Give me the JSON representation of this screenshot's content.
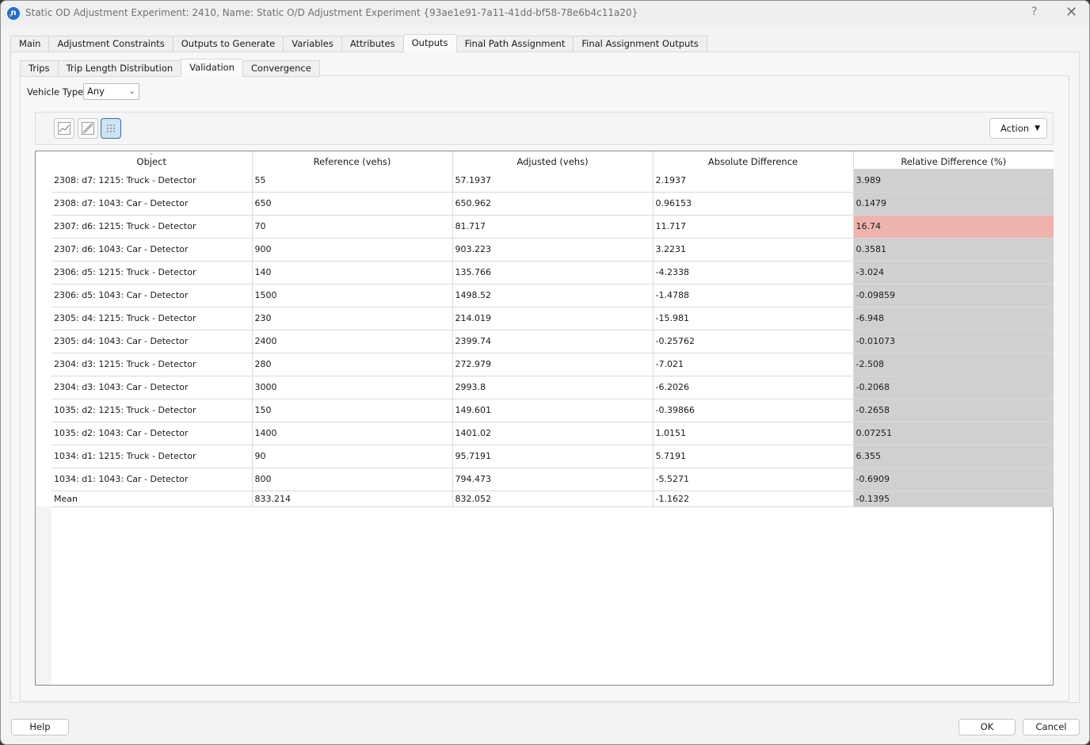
{
  "window": {
    "title": "Static OD Adjustment Experiment: 2410, Name: Static O/D Adjustment Experiment  {93ae1e91-7a11-41dd-bf58-78e6b4c11a20}",
    "app_icon": "aimsun-next-icon",
    "help_label": "?",
    "close_label": "✕"
  },
  "main_tabs": [
    {
      "label": "Main",
      "active": false
    },
    {
      "label": "Adjustment Constraints",
      "active": false
    },
    {
      "label": "Outputs to Generate",
      "active": false
    },
    {
      "label": "Variables",
      "active": false
    },
    {
      "label": "Attributes",
      "active": false
    },
    {
      "label": "Outputs",
      "active": true
    },
    {
      "label": "Final Path Assignment",
      "active": false
    },
    {
      "label": "Final Assignment Outputs",
      "active": false
    }
  ],
  "sub_tabs": [
    {
      "label": "Trips",
      "active": false
    },
    {
      "label": "Trip Length Distribution",
      "active": false
    },
    {
      "label": "Validation",
      "active": true
    },
    {
      "label": "Convergence",
      "active": false
    }
  ],
  "vehicle_type": {
    "label": "Vehicle Type:",
    "value": "Any"
  },
  "toolbar": {
    "view_buttons": [
      {
        "name": "line-chart-view-button",
        "icon": "line-chart-icon",
        "active": false
      },
      {
        "name": "scatter-chart-view-button",
        "icon": "scatter-chart-icon",
        "active": false
      },
      {
        "name": "table-view-button",
        "icon": "grid-icon",
        "active": true
      }
    ],
    "action_label": "Action",
    "action_caret": "▼"
  },
  "table": {
    "sort_indicator": "⌄",
    "columns": [
      "Object",
      "Reference (vehs)",
      "Adjusted (vehs)",
      "Absolute Difference",
      "Relative Difference (%)"
    ],
    "highlight_color": "#efb3ae",
    "rel_color": "#d0d0d0",
    "rows": [
      {
        "object": "2308: d7: 1215: Truck - Detector",
        "reference": "55",
        "adjusted": "57.1937",
        "abs_diff": "2.1937",
        "rel_diff": "3.989",
        "highlight": false
      },
      {
        "object": "2308: d7: 1043: Car - Detector",
        "reference": "650",
        "adjusted": "650.962",
        "abs_diff": "0.96153",
        "rel_diff": "0.1479",
        "highlight": false
      },
      {
        "object": "2307: d6: 1215: Truck - Detector",
        "reference": "70",
        "adjusted": "81.717",
        "abs_diff": "11.717",
        "rel_diff": "16.74",
        "highlight": true
      },
      {
        "object": "2307: d6: 1043: Car - Detector",
        "reference": "900",
        "adjusted": "903.223",
        "abs_diff": "3.2231",
        "rel_diff": "0.3581",
        "highlight": false
      },
      {
        "object": "2306: d5: 1215: Truck - Detector",
        "reference": "140",
        "adjusted": "135.766",
        "abs_diff": "-4.2338",
        "rel_diff": "-3.024",
        "highlight": false
      },
      {
        "object": "2306: d5: 1043: Car - Detector",
        "reference": "1500",
        "adjusted": "1498.52",
        "abs_diff": "-1.4788",
        "rel_diff": "-0.09859",
        "highlight": false
      },
      {
        "object": "2305: d4: 1215: Truck - Detector",
        "reference": "230",
        "adjusted": "214.019",
        "abs_diff": "-15.981",
        "rel_diff": "-6.948",
        "highlight": false
      },
      {
        "object": "2305: d4: 1043: Car - Detector",
        "reference": "2400",
        "adjusted": "2399.74",
        "abs_diff": "-0.25762",
        "rel_diff": "-0.01073",
        "highlight": false
      },
      {
        "object": "2304: d3: 1215: Truck - Detector",
        "reference": "280",
        "adjusted": "272.979",
        "abs_diff": "-7.021",
        "rel_diff": "-2.508",
        "highlight": false
      },
      {
        "object": "2304: d3: 1043: Car - Detector",
        "reference": "3000",
        "adjusted": "2993.8",
        "abs_diff": "-6.2026",
        "rel_diff": "-0.2068",
        "highlight": false
      },
      {
        "object": "1035: d2: 1215: Truck - Detector",
        "reference": "150",
        "adjusted": "149.601",
        "abs_diff": "-0.39866",
        "rel_diff": "-0.2658",
        "highlight": false
      },
      {
        "object": "1035: d2: 1043: Car - Detector",
        "reference": "1400",
        "adjusted": "1401.02",
        "abs_diff": "1.0151",
        "rel_diff": "0.07251",
        "highlight": false
      },
      {
        "object": "1034: d1: 1215: Truck - Detector",
        "reference": "90",
        "adjusted": "95.7191",
        "abs_diff": "5.7191",
        "rel_diff": "6.355",
        "highlight": false
      },
      {
        "object": "1034: d1: 1043: Car - Detector",
        "reference": "800",
        "adjusted": "794.473",
        "abs_diff": "-5.5271",
        "rel_diff": "-0.6909",
        "highlight": false
      }
    ],
    "mean": {
      "object": "Mean",
      "reference": "833.214",
      "adjusted": "832.052",
      "abs_diff": "-1.1622",
      "rel_diff": "-0.1395"
    }
  },
  "footer": {
    "help_label": "Help",
    "ok_label": "OK",
    "cancel_label": "Cancel"
  }
}
